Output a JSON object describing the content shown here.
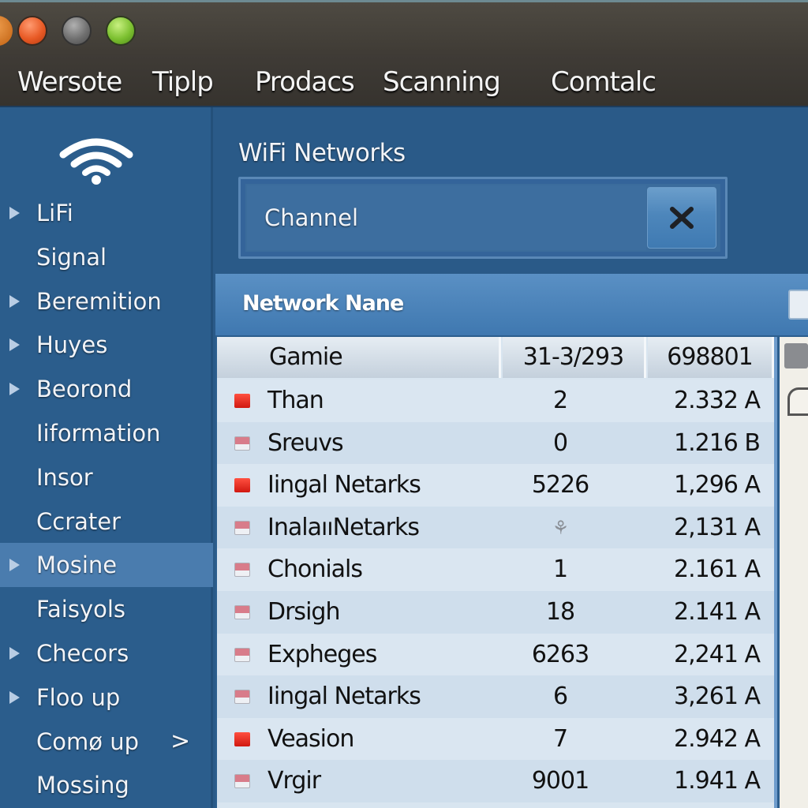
{
  "window": {
    "controls": [
      "close",
      "minimize",
      "zoom"
    ]
  },
  "menu": {
    "items": [
      "Wersote",
      "Tiplp",
      "Prodacs",
      "Scanning",
      "Comtalc"
    ]
  },
  "sidebar": {
    "logo_icon": "wifi-icon",
    "items": [
      {
        "label": "LiFi",
        "has_arrow": true
      },
      {
        "label": "Signal",
        "has_arrow": false
      },
      {
        "label": "Beremition",
        "has_arrow": true
      },
      {
        "label": "Huyes",
        "has_arrow": true
      },
      {
        "label": "Beorond",
        "has_arrow": true
      },
      {
        "label": "Iiformation",
        "has_arrow": false
      },
      {
        "label": "Insor",
        "has_arrow": false
      },
      {
        "label": "Ccrater",
        "has_arrow": false
      },
      {
        "label": "Mosine",
        "has_arrow": true,
        "active": true
      },
      {
        "label": "Faisyols",
        "has_arrow": false
      },
      {
        "label": "Checors",
        "has_arrow": true
      },
      {
        "label": "Floo up",
        "has_arrow": true
      },
      {
        "label": "Comø up",
        "has_arrow": false,
        "chevron": ">"
      },
      {
        "label": "Mossing",
        "has_arrow": false
      }
    ]
  },
  "main": {
    "title": "WiFi Networks",
    "search": {
      "value": "Channel",
      "clear_icon": "close-icon"
    }
  },
  "table": {
    "title": "Network Nane",
    "columns": [
      "Gamie",
      "31-3/293",
      "698801"
    ],
    "colors": {
      "strong": "#e02a1e",
      "weak": "#d87c8a"
    },
    "rows": [
      {
        "name": "Than",
        "channel": "2",
        "value": "2.332 A",
        "signal": "strong"
      },
      {
        "name": "Sreuvs",
        "channel": "0",
        "value": "1.216 B",
        "signal": "weak"
      },
      {
        "name": "Iingal Netarks",
        "channel": "5226",
        "value": "1,296 A",
        "signal": "strong"
      },
      {
        "name": "InalaııNetarks",
        "channel": "⚘",
        "value": "2,131 A",
        "signal": "weak",
        "channel_muted": true
      },
      {
        "name": "Chonials",
        "channel": "1",
        "value": "2.161 A",
        "signal": "weak"
      },
      {
        "name": "Drsigh",
        "channel": "18",
        "value": "2.141 A",
        "signal": "weak"
      },
      {
        "name": "Expheges",
        "channel": "6263",
        "value": "2,241 A",
        "signal": "weak"
      },
      {
        "name": "Iingal Netarks",
        "channel": "6",
        "value": "3,261 A",
        "signal": "weak"
      },
      {
        "name": "Veasion",
        "channel": "7",
        "value": "2.942 A",
        "signal": "strong"
      },
      {
        "name": "Vrgir",
        "channel": "9001",
        "value": "1.941 A",
        "signal": "weak"
      }
    ]
  }
}
